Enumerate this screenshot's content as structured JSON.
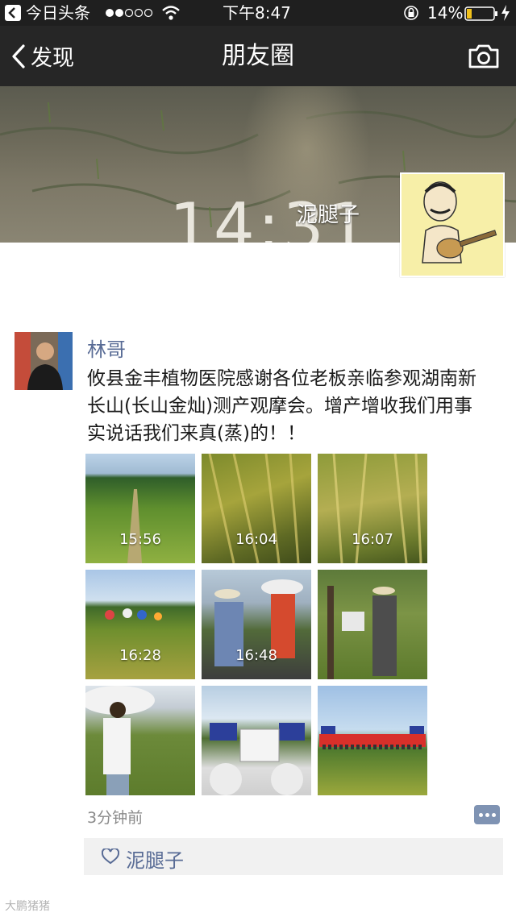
{
  "status_bar": {
    "back_app": "今日头条",
    "time": "下午8:47",
    "battery": "14%"
  },
  "nav": {
    "back_label": "发现",
    "title": "朋友圈"
  },
  "cover": {
    "time_overlay": "14:31",
    "user_name": "泥腿子"
  },
  "post": {
    "author": "林哥",
    "text": "攸县金丰植物医院感谢各位老板亲临参观湖南新长山(长山金灿)测产观摩会。增产增收我们用事实说话我们来真(蒸)的！！",
    "photos": [
      {
        "time": "15:56"
      },
      {
        "time": "16:04"
      },
      {
        "time": "16:07"
      },
      {
        "time": "16:28"
      },
      {
        "time": "16:48"
      },
      {
        "time": ""
      },
      {
        "time": ""
      },
      {
        "time": ""
      },
      {
        "time": ""
      }
    ],
    "posted_ago": "3分钟前",
    "likes": [
      "泥腿子"
    ]
  },
  "watermark": "大鹏猪猪"
}
